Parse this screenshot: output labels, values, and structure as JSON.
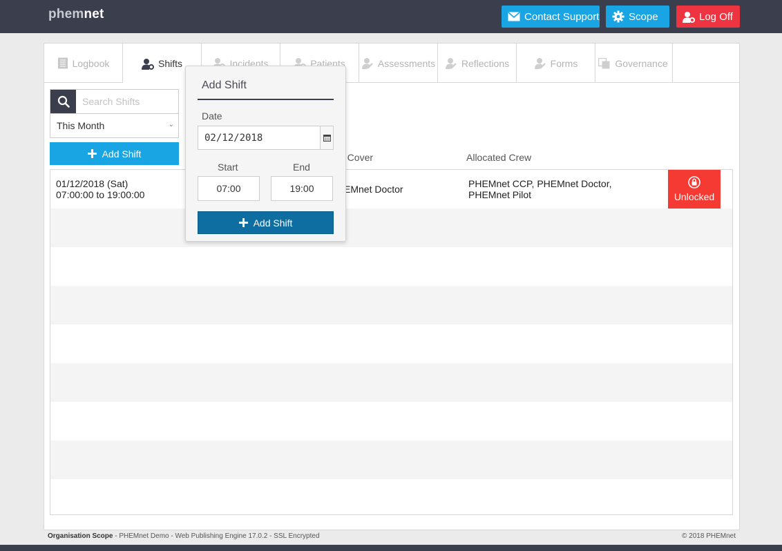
{
  "brand": {
    "logo_part1": "phem",
    "logo_part2": "net"
  },
  "header": {
    "contact_support": "Contact Support",
    "scope": "Scope",
    "log_off": "Log Off"
  },
  "tabs": [
    {
      "label": "Logbook",
      "icon": "book-icon",
      "active": false
    },
    {
      "label": "Shifts",
      "icon": "user-gear-icon",
      "active": true
    },
    {
      "label": "Incidents",
      "icon": "user-gear-icon",
      "active": false
    },
    {
      "label": "Patients",
      "icon": "user-gear-icon",
      "active": false
    },
    {
      "label": "Assessments",
      "icon": "user-pen-icon",
      "active": false
    },
    {
      "label": "Reflections",
      "icon": "user-pen-icon",
      "active": false
    },
    {
      "label": "Forms",
      "icon": "user-pen-icon",
      "active": false
    },
    {
      "label": "Governance",
      "icon": "copy-icon",
      "active": false
    }
  ],
  "sidebar": {
    "search_placeholder": "Search Shifts",
    "period": "This Month",
    "add_shift": "Add Shift"
  },
  "table": {
    "columns": {
      "cover": "o Cover",
      "crew": "Allocated Crew"
    },
    "rows": [
      {
        "date": "01/12/2018 (Sat)",
        "time": "07:00:00 to 19:00:00",
        "cover": "EMnet Doctor",
        "crew": "PHEMnet CCP, PHEMnet Doctor, PHEMnet Pilot",
        "status": "Unlocked"
      }
    ]
  },
  "popover": {
    "title": "Add Shift",
    "date_label": "Date",
    "date_value": "02/12/2018",
    "start_label": "Start",
    "start_value": "07:00",
    "end_label": "End",
    "end_value": "19:00",
    "submit": "Add Shift"
  },
  "footer": {
    "org_scope_label": "Organisation Scope",
    "org_scope_detail": " - PHEMnet Demo - Web Publishing Engine 17.0.2 - SSL Encrypted",
    "copyright": "© 2018 PHEMnet"
  },
  "colors": {
    "topbar": "#3b3e4d",
    "primary": "#19a4e3",
    "danger": "#ee3440",
    "unlocked": "#f53a33",
    "popover_button": "#0e6ea1"
  }
}
